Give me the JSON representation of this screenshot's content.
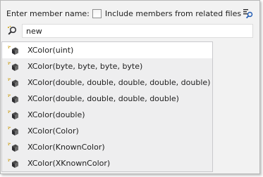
{
  "header": {
    "prompt_label": "Enter member name:",
    "include_related_label": "Include members from related files",
    "include_related_checked": false,
    "filter_icon": "filter-options-icon"
  },
  "search": {
    "value": "new",
    "icon": "search-icon"
  },
  "results": {
    "item_icon": "method-icon",
    "items": [
      {
        "label": "XColor(uint)"
      },
      {
        "label": "XColor(byte, byte, byte, byte)"
      },
      {
        "label": "XColor(double, double, double, double, double)"
      },
      {
        "label": "XColor(double, double, double, double)"
      },
      {
        "label": "XColor(double)"
      },
      {
        "label": "XColor(Color)"
      },
      {
        "label": "XColor(KnownColor)"
      },
      {
        "label": "XColor(XKnownColor)"
      }
    ]
  }
}
